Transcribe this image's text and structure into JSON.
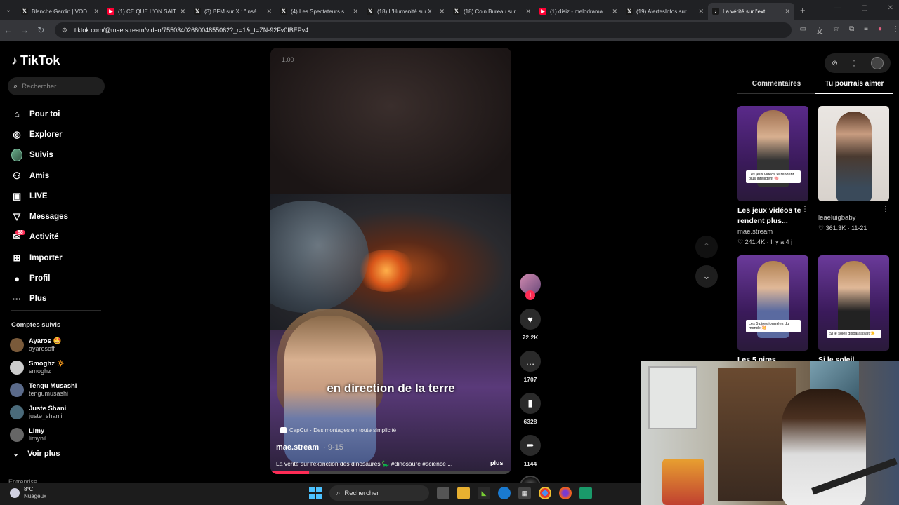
{
  "browser": {
    "tabs": [
      {
        "title": "Blanche Gardin | VOD",
        "icon": "x-icon",
        "color": "#000000"
      },
      {
        "title": "(1) CE QUE L'ON SAIT",
        "icon": "youtube-icon",
        "color": "#ff0033"
      },
      {
        "title": "(3) BFM sur X : \"Insé",
        "icon": "x-icon",
        "color": "#000000"
      },
      {
        "title": "(4) Les Spectateurs s",
        "icon": "x-icon",
        "color": "#000000"
      },
      {
        "title": "(18) L'Humanité sur X",
        "icon": "x-icon",
        "color": "#000000"
      },
      {
        "title": "(18) Coin Bureau sur",
        "icon": "x-icon",
        "color": "#000000"
      },
      {
        "title": "(1) disiz - melodrama",
        "icon": "youtube-icon",
        "color": "#ff0033"
      },
      {
        "title": "(19) AlertesInfos sur",
        "icon": "x-icon",
        "color": "#000000"
      },
      {
        "title": "La vérité sur l'ext",
        "icon": "tiktok-icon",
        "color": "#000000",
        "active": true
      }
    ],
    "url": "tiktok.com/@mae.stream/video/7550340268004855062?_r=1&_t=ZN-92Fv0IBEPv4"
  },
  "sidebar": {
    "logo": "TikTok",
    "search_placeholder": "Rechercher",
    "menu": [
      {
        "label": "Pour toi",
        "icon": "home-icon"
      },
      {
        "label": "Explorer",
        "icon": "compass-icon"
      },
      {
        "label": "Suivis",
        "icon": "avatar-icon"
      },
      {
        "label": "Amis",
        "icon": "friends-icon"
      },
      {
        "label": "LIVE",
        "icon": "live-icon"
      },
      {
        "label": "Messages",
        "icon": "send-icon"
      },
      {
        "label": "Activité",
        "icon": "inbox-icon",
        "badge": "88"
      },
      {
        "label": "Importer",
        "icon": "plus-icon"
      },
      {
        "label": "Profil",
        "icon": "profile-icon"
      },
      {
        "label": "Plus",
        "icon": "more-icon"
      }
    ],
    "following_title": "Comptes suivis",
    "following": [
      {
        "name": "Ayaros 🤩",
        "handle": "ayarosoff",
        "color": "#7a5a3a"
      },
      {
        "name": "Smoghz 🔅",
        "handle": "smoghz",
        "color": "#cccccc"
      },
      {
        "name": "Tengu Musashi",
        "handle": "tengumusashi",
        "color": "#5a6a8a"
      },
      {
        "name": "Juste Shani",
        "handle": "juste_shanii",
        "color": "#4a6a7a"
      },
      {
        "name": "Limy",
        "handle": "limynil",
        "color": "#666666"
      }
    ],
    "see_more": "Voir plus",
    "cut_label": "Entreprise"
  },
  "video": {
    "speed": "1.00",
    "caption": "en direction de la terre",
    "capcut": "CapCut · Des montages en toute simplicité",
    "author": "mae.stream",
    "date": "· 9-15",
    "description": "La vérité sur l'extinction des dinosaures 🦕 #dinosaure #science ...",
    "more": "plus",
    "progress": 0.16
  },
  "actions": {
    "likes": "72.2K",
    "comments": "1707",
    "saves": "6328",
    "shares": "1144"
  },
  "right_panel": {
    "tabs": [
      "Commentaires",
      "Tu pourrais aimer"
    ],
    "active_tab": 1,
    "cards": [
      {
        "title": "Les jeux vidéos te rendent plus...",
        "author": "mae.stream",
        "stats": "♡ 241.4K · Il y a 4 j",
        "overlay": "Les jeux vidéos te rendent plus intelligent 🧠"
      },
      {
        "title": "",
        "author": "leaeluigbaby",
        "stats": "♡ 361.3K · 11-21",
        "overlay": ""
      },
      {
        "title": "Les 5 pires",
        "author": "",
        "stats": "",
        "overlay": "Les 5 pires journées du monde 💥"
      },
      {
        "title": "Si le soleil",
        "author": "",
        "stats": "",
        "overlay": "Si le soleil disparaissait ☀️"
      }
    ]
  },
  "taskbar": {
    "temp": "8°C",
    "weather": "Nuageux",
    "search": "Rechercher"
  }
}
